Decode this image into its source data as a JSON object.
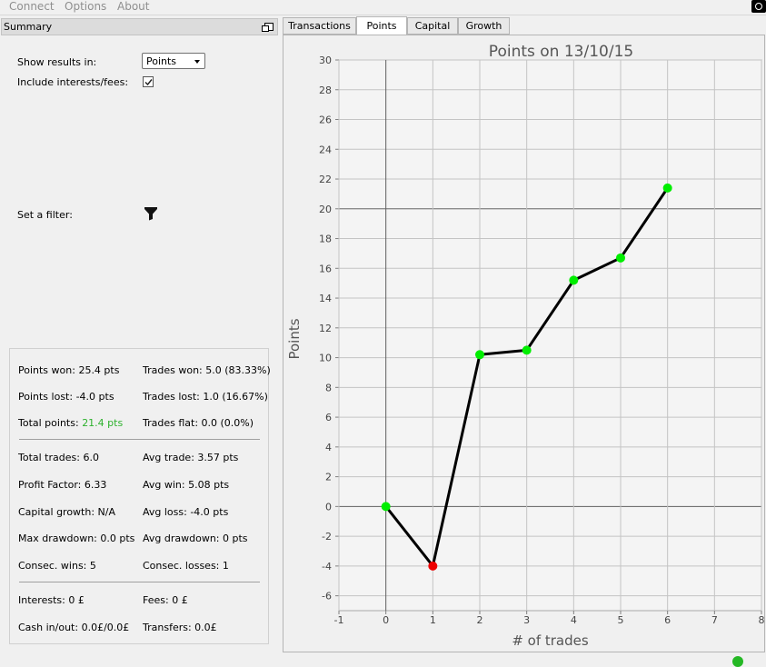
{
  "menu": {
    "items": [
      "Connect",
      "Options",
      "About"
    ]
  },
  "summary": {
    "title": "Summary",
    "show_results_label": "Show results in:",
    "show_results_value": "Points",
    "include_fees_label": "Include interests/fees:",
    "include_fees_checked": true,
    "filter_label": "Set a filter:"
  },
  "stats": {
    "points_won": "Points won: 25.4 pts",
    "trades_won": "Trades won: 5.0 (83.33%)",
    "points_lost": "Points lost: -4.0 pts",
    "trades_lost": "Trades lost: 1.0 (16.67%)",
    "total_points_label": "Total points:",
    "total_points_value": "21.4 pts",
    "trades_flat": "Trades flat: 0.0 (0.0%)",
    "total_trades": "Total trades: 6.0",
    "avg_trade": "Avg trade: 3.57 pts",
    "profit_factor": "Profit Factor: 6.33",
    "avg_win": "Avg win: 5.08 pts",
    "capital_growth": "Capital growth: N/A",
    "avg_loss": "Avg loss: -4.0 pts",
    "max_drawdown": "Max drawdown: 0.0 pts",
    "avg_drawdown": "Avg drawdown: 0 pts",
    "consec_wins": "Consec. wins: 5",
    "consec_losses": "Consec. losses: 1",
    "interests": "Interests: 0 £",
    "fees": "Fees: 0 £",
    "cash_in_out": "Cash in/out: 0.0£/0.0£",
    "transfers": "Transfers: 0.0£"
  },
  "tabs": [
    {
      "label": "Transactions",
      "active": false
    },
    {
      "label": "Points",
      "active": true
    },
    {
      "label": "Capital",
      "active": false
    },
    {
      "label": "Growth",
      "active": false
    }
  ],
  "colors": {
    "line": "#000000",
    "point_positive": "#00ee00",
    "point_negative": "#ee0000",
    "total_points_green": "#2db12d"
  },
  "chart_data": {
    "type": "line",
    "title": "Points on 13/10/15",
    "xlabel": "# of trades",
    "ylabel": "Points",
    "xlim": [
      -1,
      8
    ],
    "ylim": [
      -7,
      30
    ],
    "xticks": [
      -1,
      0,
      1,
      2,
      3,
      4,
      5,
      6,
      7,
      8
    ],
    "yticks": [
      -6,
      -4,
      -2,
      0,
      2,
      4,
      6,
      8,
      10,
      12,
      14,
      16,
      18,
      20,
      22,
      24,
      26,
      28,
      30
    ],
    "grid": true,
    "x": [
      0,
      1,
      2,
      3,
      4,
      5,
      6
    ],
    "y": [
      0,
      -4,
      10.2,
      10.5,
      15.2,
      16.7,
      21.4
    ],
    "point_colors": [
      "green",
      "red",
      "green",
      "green",
      "green",
      "green",
      "green"
    ]
  }
}
